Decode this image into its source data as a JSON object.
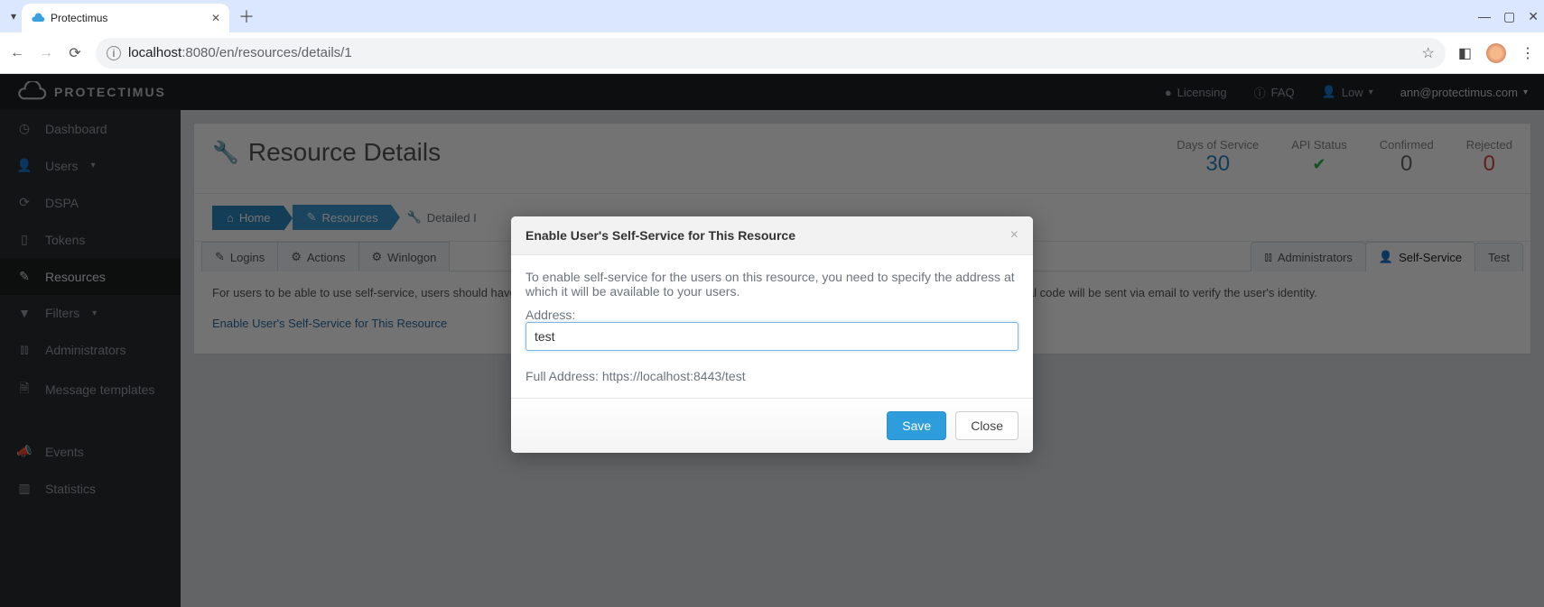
{
  "browser": {
    "tab_title": "Protectimus",
    "url_host": "localhost",
    "url_port": ":8080",
    "url_path": "/en/resources/details/1"
  },
  "header": {
    "brand": "PROTECTIMUS",
    "licensing": "Licensing",
    "faq": "FAQ",
    "level": "Low",
    "user_email": "ann@protectimus.com"
  },
  "sidebar": {
    "dashboard": "Dashboard",
    "users": "Users",
    "dspa": "DSPA",
    "tokens": "Tokens",
    "resources": "Resources",
    "filters": "Filters",
    "administrators": "Administrators",
    "msg_templates": "Message templates",
    "events": "Events",
    "statistics": "Statistics"
  },
  "panel": {
    "title": "Resource Details",
    "stats": {
      "days_label": "Days of Service",
      "days_value": "30",
      "api_label": "API Status",
      "api_value": "✔",
      "confirmed_label": "Confirmed",
      "confirmed_value": "0",
      "rejected_label": "Rejected",
      "rejected_value": "0"
    }
  },
  "breadcrumb": {
    "home": "Home",
    "resources": "Resources",
    "detail": "Detailed I"
  },
  "tabs": {
    "logins": "Logins",
    "actions": "Actions",
    "winlogon": "Winlogon",
    "administrators": "Administrators",
    "self_service": "Self-Service",
    "test": "Test"
  },
  "body_text": "For users to be able to use self-service, users should have passwords. The passwords will authenticate users for self-service; if there is no password, a special code will be sent via email to verify the user's identity.",
  "body_link": "Enable User's Self-Service for This Resource",
  "modal": {
    "title": "Enable User's Self-Service for This Resource",
    "description": "To enable self-service for the users on this resource, you need to specify the address at which it will be available to your users.",
    "address_label": "Address:",
    "address_value": "test",
    "full_address_label": "Full Address:",
    "full_address_value": "https://localhost:8443/test",
    "save": "Save",
    "close": "Close"
  }
}
